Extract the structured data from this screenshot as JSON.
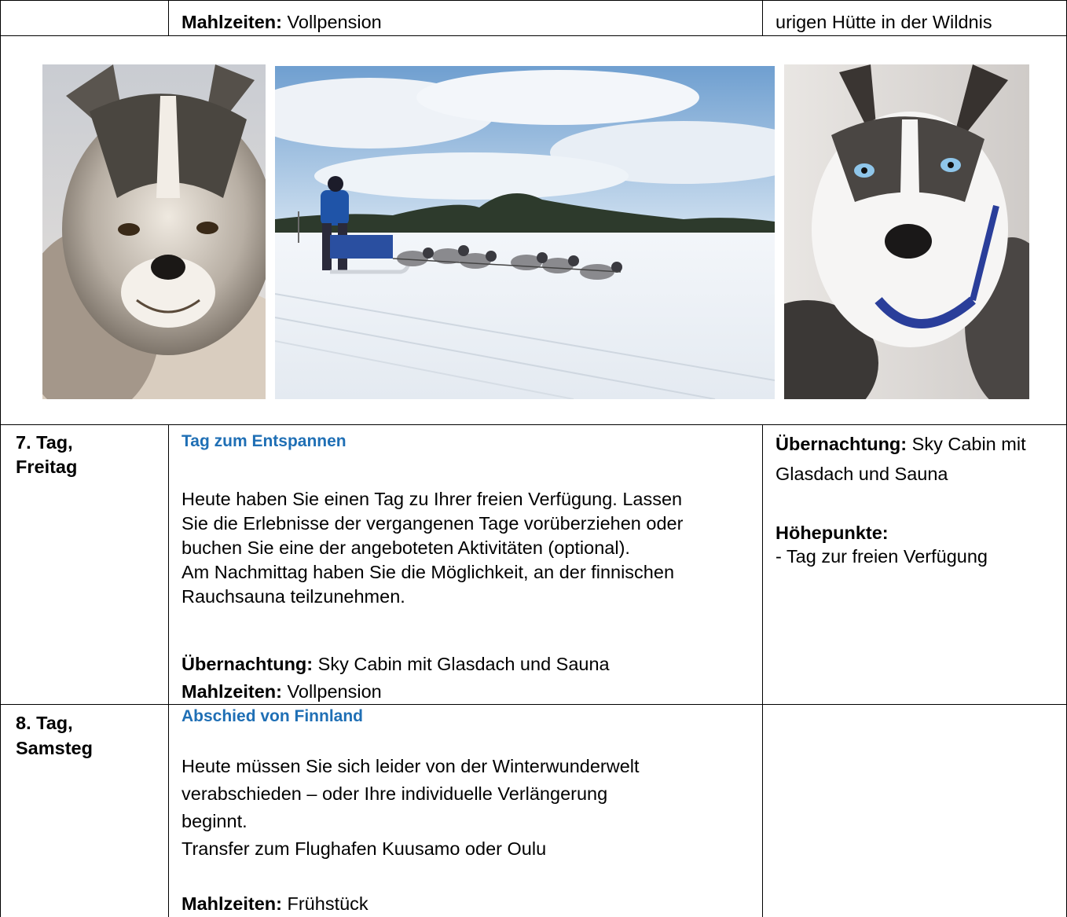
{
  "top_row": {
    "meals_label": "Mahlzeiten:",
    "meals_value": "Vollpension",
    "right_text": "urigen Hütte in der Wildnis"
  },
  "photos": {
    "left": "husky-portrait-photo",
    "center": "dog-sled-team-photo",
    "right": "blue-eyed-husky-photo"
  },
  "day7": {
    "day_line1": "7. Tag,",
    "day_line2": "Freitag",
    "heading": "Tag zum Entspannen",
    "para_lines": [
      "Heute haben Sie einen Tag zu Ihrer freien Verfügung. Lassen",
      "Sie die Erlebnisse der vergangenen Tage vorüberziehen oder",
      "buchen Sie eine der angeboteten Aktivitäten (optional).",
      "Am Nachmittag haben Sie die Möglichkeit, an der finnischen",
      "Rauchsauna teilzunehmen."
    ],
    "stay_label": "Übernachtung:",
    "stay_value": "Sky Cabin mit Glasdach und Sauna",
    "meals_label": "Mahlzeiten:",
    "meals_value": "Vollpension",
    "side_stay_label": "Übernachtung:",
    "side_stay_value_1": "Sky Cabin mit",
    "side_stay_value_2": "Glasdach und Sauna",
    "highlights_label": "Höhepunkte:",
    "highlight_1": "- Tag zur freien Verfügung"
  },
  "day8": {
    "day_line1": "8. Tag,",
    "day_line2": "Samsteg",
    "heading": "Abschied von Finnland",
    "para_lines": [
      "Heute müssen Sie sich leider von der Winterwunderwelt",
      "verabschieden – oder Ihre individuelle Verlängerung",
      "beginnt.",
      "Transfer zum Flughafen Kuusamo oder Oulu"
    ],
    "meals_label": "Mahlzeiten:",
    "meals_value": "Frühstück"
  }
}
